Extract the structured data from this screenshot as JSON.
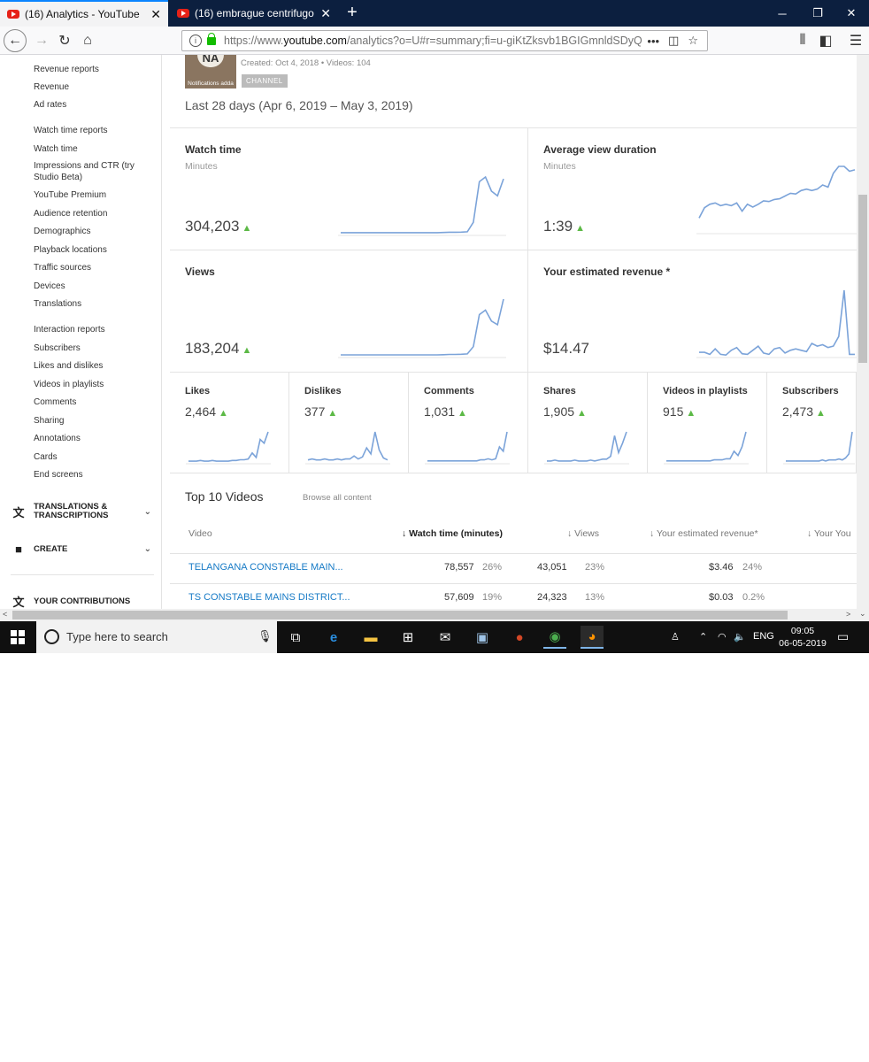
{
  "browser": {
    "tabs": [
      {
        "label": "(16) Analytics - YouTube",
        "active": true
      },
      {
        "label": "(16) embrague centrifugo casero",
        "active": false
      }
    ],
    "url_prefix": "https://www.",
    "url_domain": "youtube.com",
    "url_path": "/analytics?o=U#r=summary;fi=u-giKtZksvb1BGIGmnldSDyQ"
  },
  "sidebar": {
    "revenue_items": [
      "Revenue reports",
      "Revenue",
      "Ad rates"
    ],
    "watch_items": [
      "Watch time reports",
      "Watch time",
      "Impressions and CTR (try Studio Beta)",
      "YouTube Premium",
      "Audience retention",
      "Demographics",
      "Playback locations",
      "Traffic sources",
      "Devices",
      "Translations"
    ],
    "interaction_items": [
      "Interaction reports",
      "Subscribers",
      "Likes and dislikes",
      "Videos in playlists",
      "Comments",
      "Sharing",
      "Annotations",
      "Cards",
      "End screens"
    ],
    "sections": {
      "translations": "TRANSLATIONS & TRANSCRIPTIONS",
      "create": "CREATE",
      "contributions": "YOUR CONTRIBUTIONS"
    }
  },
  "channel": {
    "avatar_initials": "NA",
    "avatar_caption": "Notifications adda",
    "meta": "Created: Oct 4, 2018  •  Videos: 104",
    "badge": "CHANNEL",
    "date_range": "Last 28 days (Apr 6, 2019 – May 3, 2019)"
  },
  "cards": {
    "watch_time": {
      "title": "Watch time",
      "unit": "Minutes",
      "value": "304,203"
    },
    "avg_view_duration": {
      "title": "Average view duration",
      "unit": "Minutes",
      "value": "1:39"
    },
    "views": {
      "title": "Views",
      "unit": "",
      "value": "183,204"
    },
    "revenue": {
      "title": "Your estimated revenue *",
      "unit": "",
      "value": "$14.47"
    }
  },
  "mini_cards": [
    {
      "label": "Likes",
      "value": "2,464"
    },
    {
      "label": "Dislikes",
      "value": "377"
    },
    {
      "label": "Comments",
      "value": "1,031"
    },
    {
      "label": "Shares",
      "value": "1,905"
    },
    {
      "label": "Videos in playlists",
      "value": "915"
    },
    {
      "label": "Subscribers",
      "value": "2,473"
    }
  ],
  "chart_data": [
    {
      "type": "line",
      "series": [
        {
          "values": [
            1,
            1,
            1,
            1,
            1,
            1,
            1,
            1,
            1,
            1,
            1,
            1,
            1,
            1,
            1,
            1,
            1,
            1.2,
            1.5,
            1.5,
            1.6,
            2,
            12,
            55,
            60,
            45,
            40,
            58
          ]
        }
      ]
    },
    {
      "type": "line",
      "series": [
        {
          "values": [
            20,
            35,
            40,
            42,
            38,
            40,
            38,
            42,
            30,
            40,
            36,
            40,
            45,
            44,
            47,
            48,
            52,
            56,
            55,
            60,
            62,
            60,
            62,
            68,
            65,
            85,
            95,
            95,
            88,
            90
          ]
        }
      ]
    },
    {
      "type": "line",
      "series": [
        {
          "values": [
            1,
            1,
            1,
            1,
            1,
            1,
            1,
            1,
            1,
            1,
            1,
            1,
            1,
            1,
            1,
            1,
            1,
            1.2,
            1.5,
            1.5,
            1.6,
            2,
            10,
            45,
            50,
            38,
            34,
            62
          ]
        }
      ]
    },
    {
      "type": "line",
      "series": [
        {
          "values": [
            5,
            5,
            2,
            10,
            2,
            1,
            8,
            12,
            3,
            2,
            8,
            14,
            4,
            2,
            10,
            12,
            4,
            8,
            10,
            8,
            6,
            18,
            14,
            16,
            12,
            14,
            28,
            95,
            2,
            2
          ]
        }
      ]
    },
    {
      "type": "line",
      "series": [
        {
          "values": [
            1,
            1,
            1,
            2,
            1,
            1,
            2,
            1,
            1,
            1,
            1,
            2,
            2,
            3,
            3,
            4,
            12,
            6,
            30,
            25,
            40
          ]
        }
      ]
    },
    {
      "type": "line",
      "series": [
        {
          "values": [
            2,
            3,
            2,
            2,
            3,
            2,
            2,
            3,
            2,
            3,
            3,
            6,
            3,
            5,
            14,
            8,
            30,
            12,
            4,
            2
          ]
        }
      ]
    },
    {
      "type": "line",
      "series": [
        {
          "values": [
            1,
            1,
            1,
            1,
            1,
            1,
            1,
            1,
            1,
            1,
            1,
            1,
            1,
            1,
            2,
            2,
            3,
            2,
            3,
            14,
            10,
            28
          ]
        }
      ]
    },
    {
      "type": "line",
      "series": [
        {
          "values": [
            1,
            1,
            2,
            1,
            1,
            1,
            1,
            2,
            1,
            1,
            1,
            2,
            1,
            2,
            3,
            3,
            6,
            28,
            10,
            20,
            32
          ]
        }
      ]
    },
    {
      "type": "line",
      "series": [
        {
          "values": [
            1,
            1,
            1,
            1,
            1,
            1,
            1,
            1,
            1,
            1,
            1,
            1,
            2,
            2,
            2,
            3,
            3,
            10,
            6,
            14,
            28
          ]
        }
      ]
    },
    {
      "type": "line",
      "series": [
        {
          "values": [
            1,
            1,
            1,
            1,
            1,
            1,
            1,
            1,
            1,
            1,
            1,
            2,
            1,
            2,
            2,
            2,
            3,
            2,
            4,
            8,
            30
          ]
        }
      ]
    }
  ],
  "top10": {
    "title": "Top 10 Videos",
    "browse": "Browse all content",
    "columns": [
      "Video",
      "Watch time (minutes)",
      "Views",
      "Your estimated revenue*",
      "Your You"
    ],
    "rows": [
      {
        "video": "TELANGANA CONSTABLE MAIN...",
        "watch": "78,557",
        "watch_pct": "26%",
        "views": "43,051",
        "views_pct": "23%",
        "revenue": "$3.46",
        "revenue_pct": "24%"
      },
      {
        "video": "TS CONSTABLE MAINS DISTRICT...",
        "watch": "57,609",
        "watch_pct": "19%",
        "views": "24,323",
        "views_pct": "13%",
        "revenue": "$0.03",
        "revenue_pct": "0.2%"
      }
    ]
  },
  "taskbar": {
    "search_placeholder": "Type here to search",
    "lang": "ENG",
    "time": "09:05",
    "date": "06-05-2019"
  },
  "colors": {
    "accent_blue": "#167ac6",
    "chart_line": "#7ba3d9",
    "trend_up": "#5cb946"
  }
}
